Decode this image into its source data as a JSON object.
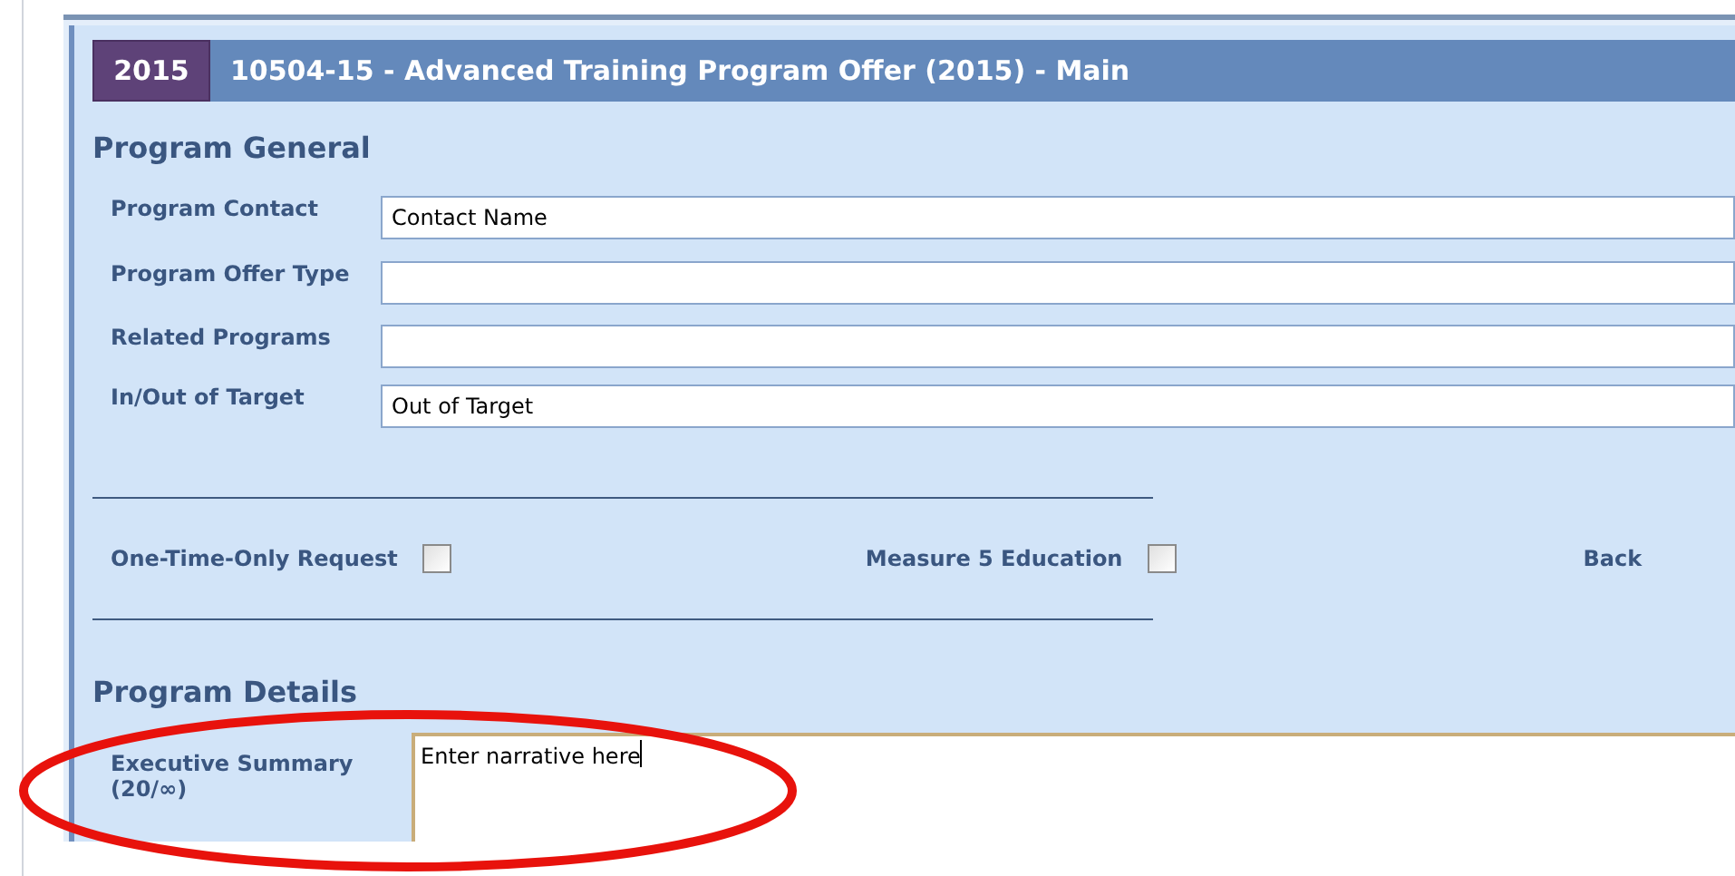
{
  "header": {
    "year": "2015",
    "title": "10504-15 - Advanced Training Program Offer (2015) - Main"
  },
  "general": {
    "title": "Program General",
    "fields": [
      {
        "label": "Program Contact",
        "value": "Contact Name"
      },
      {
        "label": "Program Offer Type"
      },
      {
        "label": "Related Programs"
      },
      {
        "label": "In/Out of Target",
        "value": "Out of Target"
      }
    ]
  },
  "checkboxes": [
    {
      "label": "One-Time-Only Request",
      "checked": false
    },
    {
      "label": "Measure 5 Education",
      "checked": false
    },
    {
      "label": "Back"
    }
  ],
  "details": {
    "title": "Program Details",
    "executive_summary": {
      "label": "Executive Summary",
      "counter": "(20/∞)",
      "value": "Enter narrative here"
    }
  }
}
